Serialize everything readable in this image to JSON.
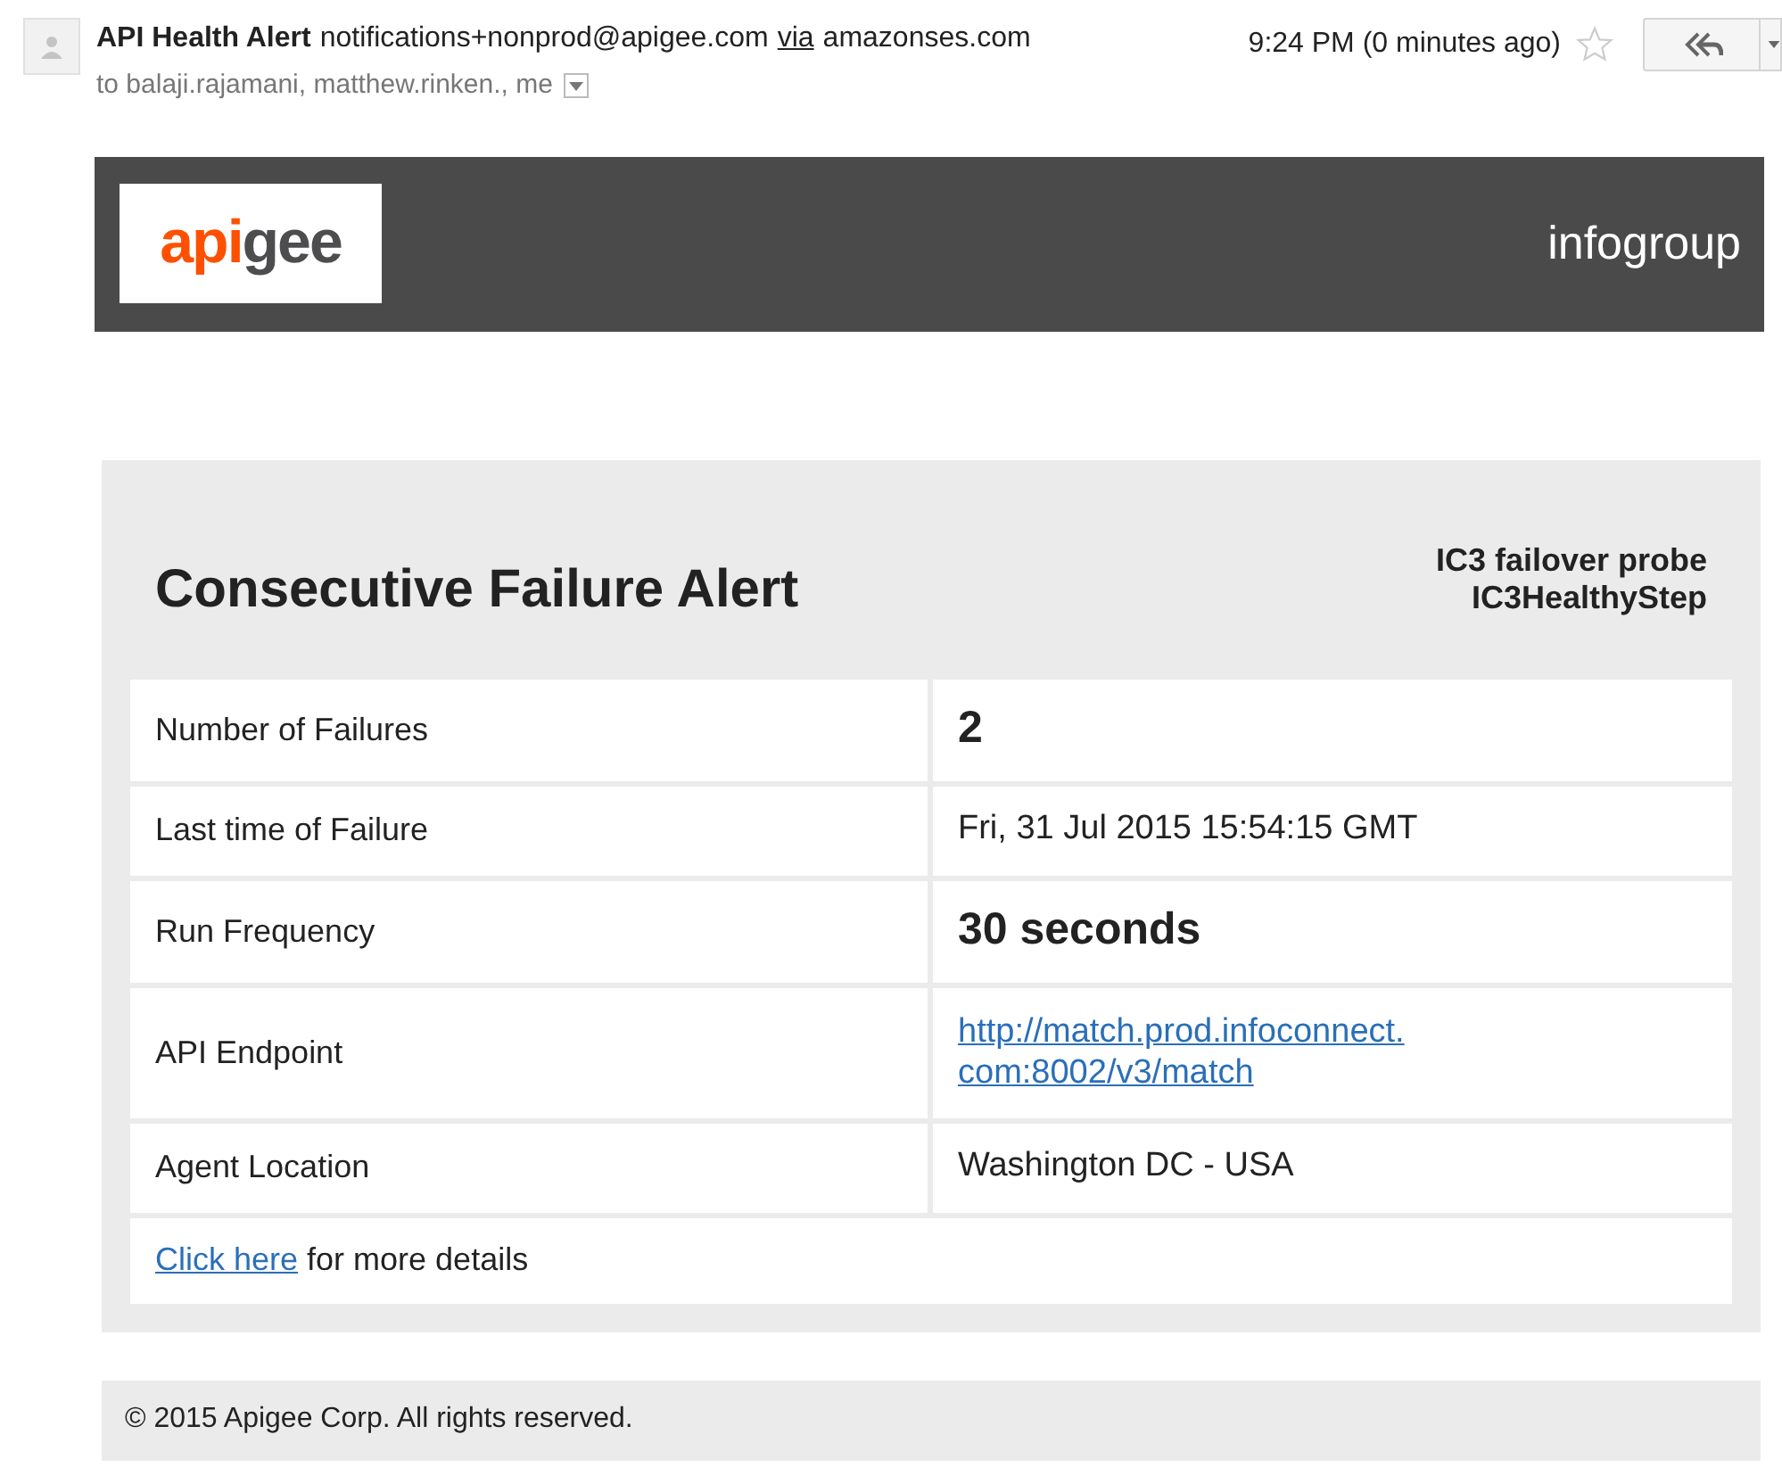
{
  "header": {
    "sender_name": "API Health Alert",
    "sender_email": "notifications+nonprod@apigee.com",
    "via": "via",
    "via_domain": "amazonses.com",
    "time": "9:24 PM (0 minutes ago)",
    "starred": false,
    "recipients": "to balaji.rajamani, matthew.rinken., me"
  },
  "banner": {
    "logo": [
      {
        "text": "api",
        "color": "#fe5000"
      },
      {
        "text": "gee",
        "color": "#4d4d4f"
      }
    ],
    "company": "infogroup"
  },
  "alert": {
    "title": "Consecutive Failure Alert",
    "probe": "IC3 failover probe",
    "step": "IC3HealthyStep",
    "rows": [
      {
        "label": "Number of Failures",
        "value": "2",
        "kind": "big"
      },
      {
        "label": "Last time of Failure",
        "value": "Fri, 31 Jul 2015 15:54:15 GMT",
        "kind": "plain"
      },
      {
        "label": "Run Frequency",
        "value": "30 seconds",
        "kind": "big"
      },
      {
        "label": "API Endpoint",
        "value": "http://match.prod.infoconnect.\ncom:8002/v3/match",
        "kind": "link"
      },
      {
        "label": "Agent Location",
        "value": "Washington DC - USA",
        "kind": "plain"
      }
    ],
    "details_link": "Click here",
    "details_text": "for more details"
  },
  "footer": "© 2015 Apigee Corp. All rights reserved."
}
